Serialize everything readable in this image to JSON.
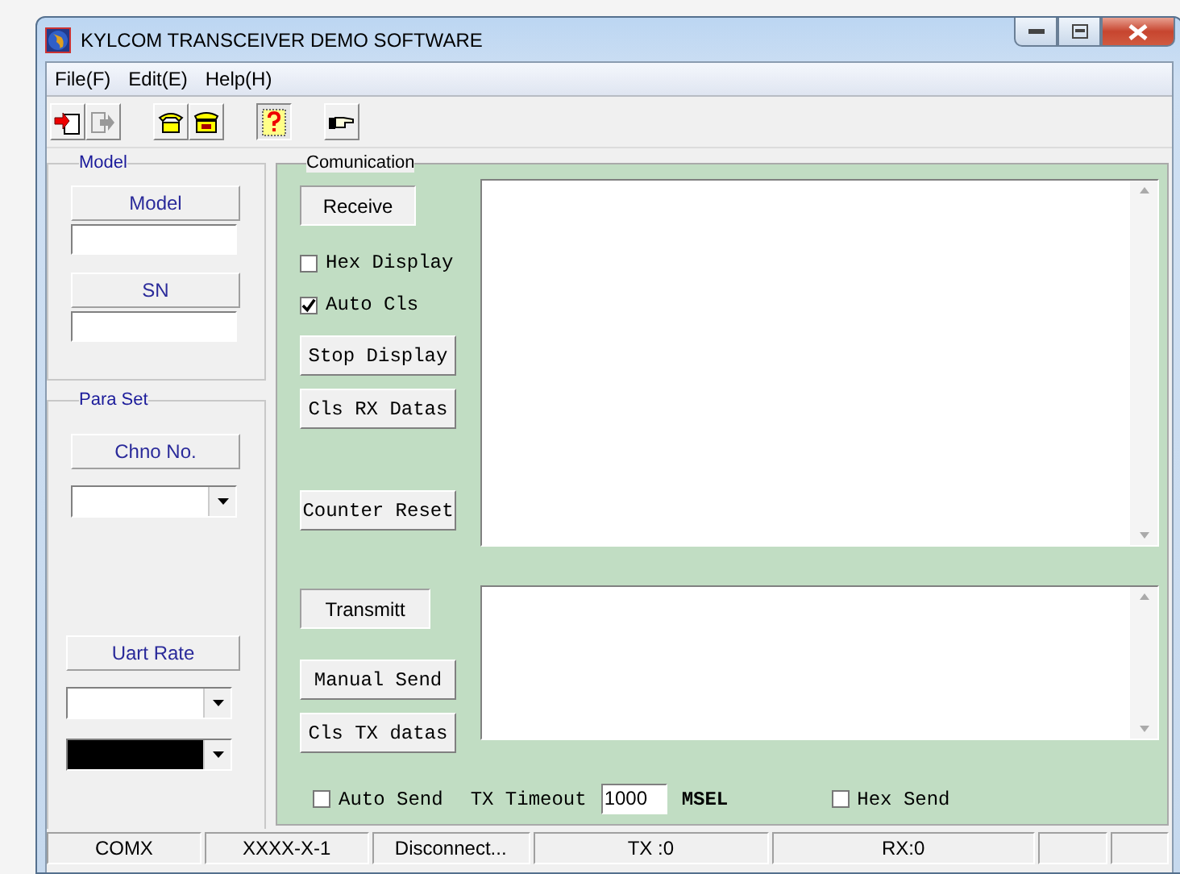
{
  "window": {
    "title": "KYLCOM TRANSCEIVER DEMO SOFTWARE"
  },
  "menu": [
    "File(F)",
    "Edit(E)",
    "Help(H)"
  ],
  "model_group": {
    "title": "Model",
    "model_button": "Model",
    "sn_button": "SN"
  },
  "para_set": {
    "title": "Para Set",
    "chno_button": "Chno No.",
    "uart_button": "Uart Rate"
  },
  "communication": {
    "title": "Comunication",
    "receive_button": "Receive",
    "hex_display": {
      "label": "Hex Display",
      "checked": false
    },
    "auto_cls": {
      "label": "Auto Cls",
      "checked": true
    },
    "stop_display": "Stop Display",
    "cls_rx": "Cls RX Datas",
    "counter_reset": "Counter Reset",
    "transmit_button": "Transmitt",
    "manual_send": "Manual Send",
    "cls_tx": "Cls TX datas",
    "auto_send": {
      "label": "Auto Send",
      "checked": false
    },
    "tx_timeout_label": "TX Timeout",
    "tx_timeout": "1000",
    "unit": "MSEL",
    "hex_send": {
      "label": "Hex Send",
      "checked": false
    }
  },
  "status_bar": [
    "COMX",
    "XXXX-X-1",
    "Disconnect...",
    "TX :0",
    "RX:0"
  ]
}
